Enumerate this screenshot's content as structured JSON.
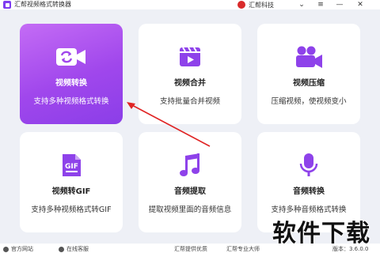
{
  "app": {
    "title": "汇帮视频格式转换器"
  },
  "brand": {
    "name": "汇帮科技"
  },
  "window_controls": {
    "chevron": "⌄",
    "menu": "≡",
    "minimize": "—",
    "close": "✕"
  },
  "cards": [
    {
      "id": "video-convert",
      "title": "视频转换",
      "desc": "支持多种视频格式转换",
      "icon": "video-convert-icon",
      "active": true
    },
    {
      "id": "video-merge",
      "title": "视频合并",
      "desc": "支持批量合并视频",
      "icon": "clapperboard-icon",
      "active": false
    },
    {
      "id": "video-compress",
      "title": "视频压缩",
      "desc": "压缩视频，使视频变小",
      "icon": "movie-camera-icon",
      "active": false
    },
    {
      "id": "video-to-gif",
      "title": "视频转GIF",
      "desc": "支持多种视频格式转GIF",
      "icon": "gif-file-icon",
      "active": false
    },
    {
      "id": "audio-extract",
      "title": "音频提取",
      "desc": "提取视频里面的音频信息",
      "icon": "music-note-icon",
      "active": false
    },
    {
      "id": "audio-convert",
      "title": "音频转换",
      "desc": "支持多种音频格式转换",
      "icon": "microphone-icon",
      "active": false
    }
  ],
  "footer": {
    "website": "官方网站",
    "support": "在线客服",
    "slogan1": "汇帮提供优质",
    "slogan2": "汇帮专业大师",
    "version": "版本：3.6.0.0"
  },
  "watermark": "软件下载",
  "colors": {
    "accent": "#8e42ea",
    "accent_light": "#c46cf5",
    "arrow": "#e02424"
  }
}
